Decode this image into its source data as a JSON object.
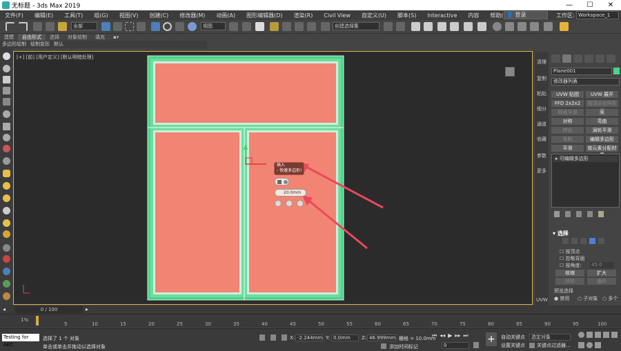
{
  "window": {
    "title": "无标题 - 3ds Max 2019",
    "min": "—",
    "max": "☐",
    "close": "✕"
  },
  "menu": [
    "文件(F)",
    "编辑(E)",
    "工具(T)",
    "组(G)",
    "视图(V)",
    "创建(C)",
    "修改器(M)",
    "动画(A)",
    "图形编辑器(D)",
    "渲染(R)",
    "Civil View",
    "自定义(U)",
    "脚本(S)",
    "Interactive",
    "内容",
    "帮助(H)"
  ],
  "login": {
    "label": "登录"
  },
  "workspace": {
    "label": "工作区:",
    "value": "Workspace_1"
  },
  "toolbar": {
    "selection_filter": "全部",
    "ref_coord": "视图",
    "named_sel": "创建选择集"
  },
  "ribbon": {
    "tabs": [
      "建模",
      "自由形式",
      "选择",
      "对象绘制",
      "填充"
    ],
    "active_tab": "自由形式",
    "subtabs": [
      "多边形绘制",
      "绘制变形",
      "默认"
    ]
  },
  "viewport": {
    "label": "[+] [前] [用户定义] [默认明暗处理]"
  },
  "caddy": {
    "title": "插入",
    "subtitle": "- 快速多边形!",
    "value": "20.0mm"
  },
  "rightstrip": [
    "清理",
    "复制",
    "粘贴",
    "细分",
    "通道",
    "收藏",
    "参数",
    "更多",
    "UVW"
  ],
  "panel": {
    "object_name": "Plane001",
    "modifier_list": "修改器列表",
    "buttons": [
      {
        "label": "UVW 贴图",
        "dim": false
      },
      {
        "label": "UVW 展开",
        "dim": false
      },
      {
        "label": "FFD 2x2x2",
        "dim": false
      },
      {
        "label": "按顶点化样条线",
        "dim": true
      },
      {
        "label": "网格平滑",
        "dim": true
      },
      {
        "label": "壳",
        "dim": false
      },
      {
        "label": "对称",
        "dim": false
      },
      {
        "label": "弯曲",
        "dim": false
      },
      {
        "label": "挤出",
        "dim": true
      },
      {
        "label": "涡轮平滑",
        "dim": false
      },
      {
        "label": "车削",
        "dim": true
      },
      {
        "label": "编辑多边形",
        "dim": false
      },
      {
        "label": "平滑",
        "dim": false
      },
      {
        "label": "按元素分配材质",
        "dim": false
      }
    ],
    "stack_item": "可编辑多边形",
    "selection": {
      "header": "选择",
      "by_vertex": "按顶点",
      "ignore_back": "忽略背面",
      "by_angle": "按角度:",
      "angle_value": "45.0",
      "shrink": "收缩",
      "grow": "扩大",
      "ring": "环形",
      "loop": "循环",
      "preview": "预览选择",
      "disabled": "禁用",
      "subobject": "子对象",
      "multi": "多个"
    }
  },
  "timeline": {
    "slider": "0 / 100",
    "ticks": [
      "0",
      "5",
      "10",
      "15",
      "20",
      "25",
      "30",
      "35",
      "40",
      "45",
      "50",
      "55",
      "60",
      "65",
      "70",
      "75",
      "80",
      "85",
      "90",
      "95",
      "100"
    ],
    "pct": "1%"
  },
  "status": {
    "maxscript": "Testing for AEC",
    "selected": "选择了 1 个 对象",
    "prompt": "单击或单击并拖动以选择对象",
    "x_label": "X:",
    "x_value": "-2.244mm",
    "y_label": "Y:",
    "y_value": "0.0mm",
    "z_label": "Z:",
    "z_value": "46.999mm",
    "grid": "栅格 = 10.0mm",
    "add_tag": "添加时间标记",
    "frame": "0",
    "autokey": "自动关键点",
    "setkey": "设置关键点",
    "key_select": "选定对象",
    "key_filter": "关键点过滤器..."
  },
  "colors": {
    "accent": "#d8b54a",
    "frame": "#4cd48a",
    "glass": "#f28473"
  }
}
